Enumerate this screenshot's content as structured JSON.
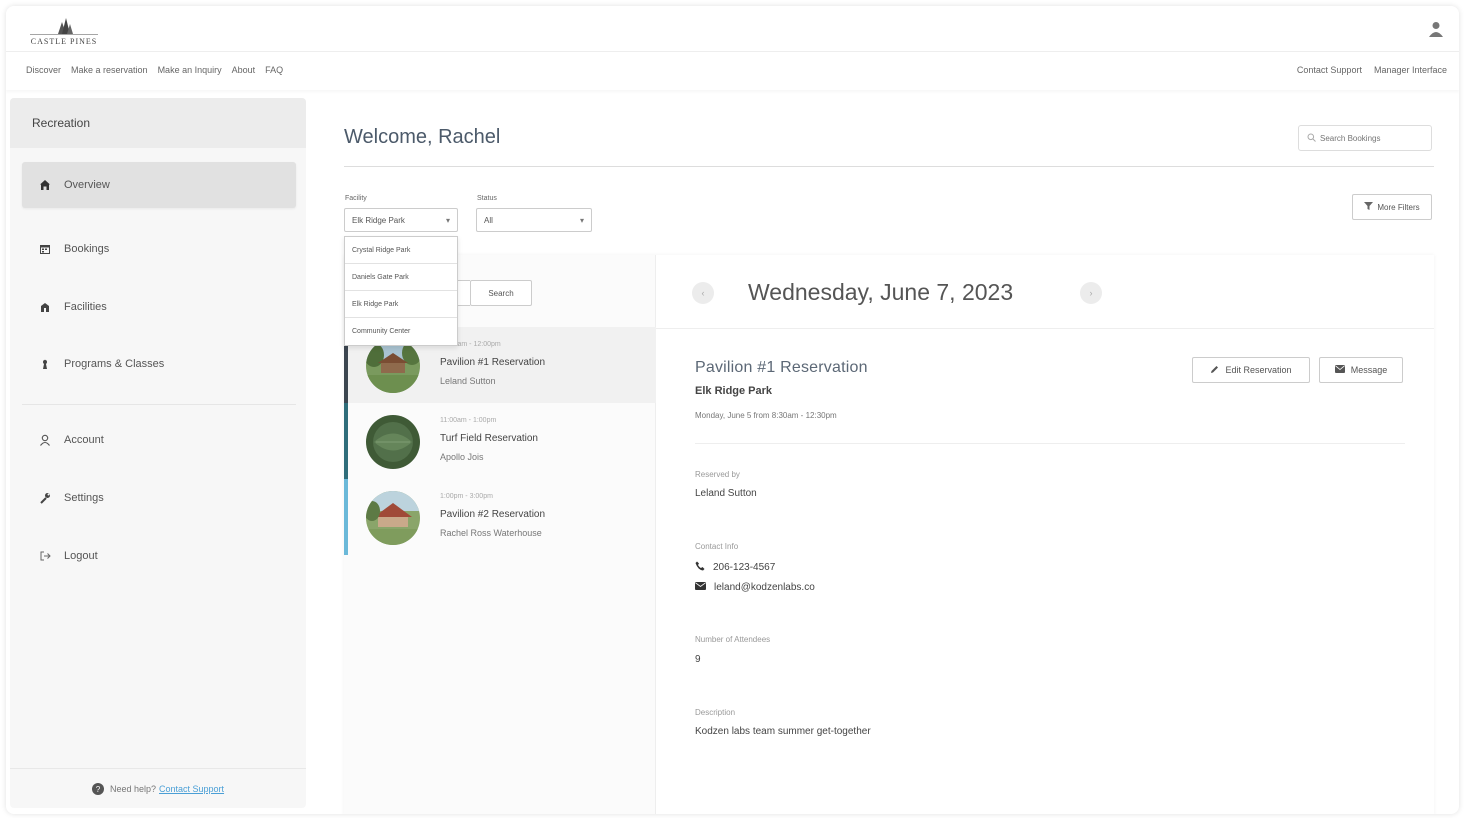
{
  "brand": {
    "logo_text": "CASTLE PINES"
  },
  "nav": {
    "left": [
      "Discover",
      "Make a reservation",
      "Make an Inquiry",
      "About",
      "FAQ"
    ],
    "right": [
      "Contact Support",
      "Manager Interface"
    ]
  },
  "sidebar": {
    "title": "Recreation",
    "items": [
      {
        "label": "Overview",
        "icon": "home-icon"
      },
      {
        "label": "Bookings",
        "icon": "calendar-icon"
      },
      {
        "label": "Facilities",
        "icon": "facility-icon"
      },
      {
        "label": "Programs & Classes",
        "icon": "programs-icon"
      }
    ],
    "account_items": [
      {
        "label": "Account",
        "icon": "user-icon"
      },
      {
        "label": "Settings",
        "icon": "wrench-icon"
      },
      {
        "label": "Logout",
        "icon": "logout-icon"
      }
    ],
    "footer": {
      "prefix": "Need help?",
      "link": "Contact Support"
    }
  },
  "header": {
    "welcome": "Welcome, Rachel",
    "search_placeholder": "Search Bookings"
  },
  "filters": {
    "facility_label": "Facility",
    "facility_value": "Elk Ridge Park",
    "facility_options": [
      "Crystal Ridge Park",
      "Daniels Gate Park",
      "Elk Ridge Park",
      "Community Center"
    ],
    "status_label": "Status",
    "status_value": "All",
    "more_filters": "More Filters",
    "search_button": "Search"
  },
  "date": {
    "title": "Wednesday, June 7, 2023"
  },
  "reservations": [
    {
      "time": "10:00am - 12:00pm",
      "title": "Pavilion #1 Reservation",
      "person": "Leland Sutton",
      "bar_color": "#3c4650",
      "thumb": "pavilion"
    },
    {
      "time": "11:00am - 1:00pm",
      "title": "Turf Field Reservation",
      "person": "Apollo Jois",
      "bar_color": "#2f6d7a",
      "thumb": "field"
    },
    {
      "time": "1:00pm - 3:00pm",
      "title": "Pavilion #2 Reservation",
      "person": "Rachel Ross Waterhouse",
      "bar_color": "#6bb9d9",
      "thumb": "pavilion2"
    }
  ],
  "detail": {
    "title": "Pavilion #1 Reservation",
    "park": "Elk Ridge Park",
    "when": "Monday, June 5 from 8:30am - 12:30pm",
    "edit_button": "Edit Reservation",
    "message_button": "Message",
    "reserved_by_label": "Reserved by",
    "reserved_by": "Leland Sutton",
    "contact_label": "Contact Info",
    "phone": "206-123-4567",
    "email": "leland@kodzenlabs.co",
    "attendees_label": "Number of Attendees",
    "attendees": "9",
    "description_label": "Description",
    "description": "Kodzen labs team summer get-together"
  }
}
